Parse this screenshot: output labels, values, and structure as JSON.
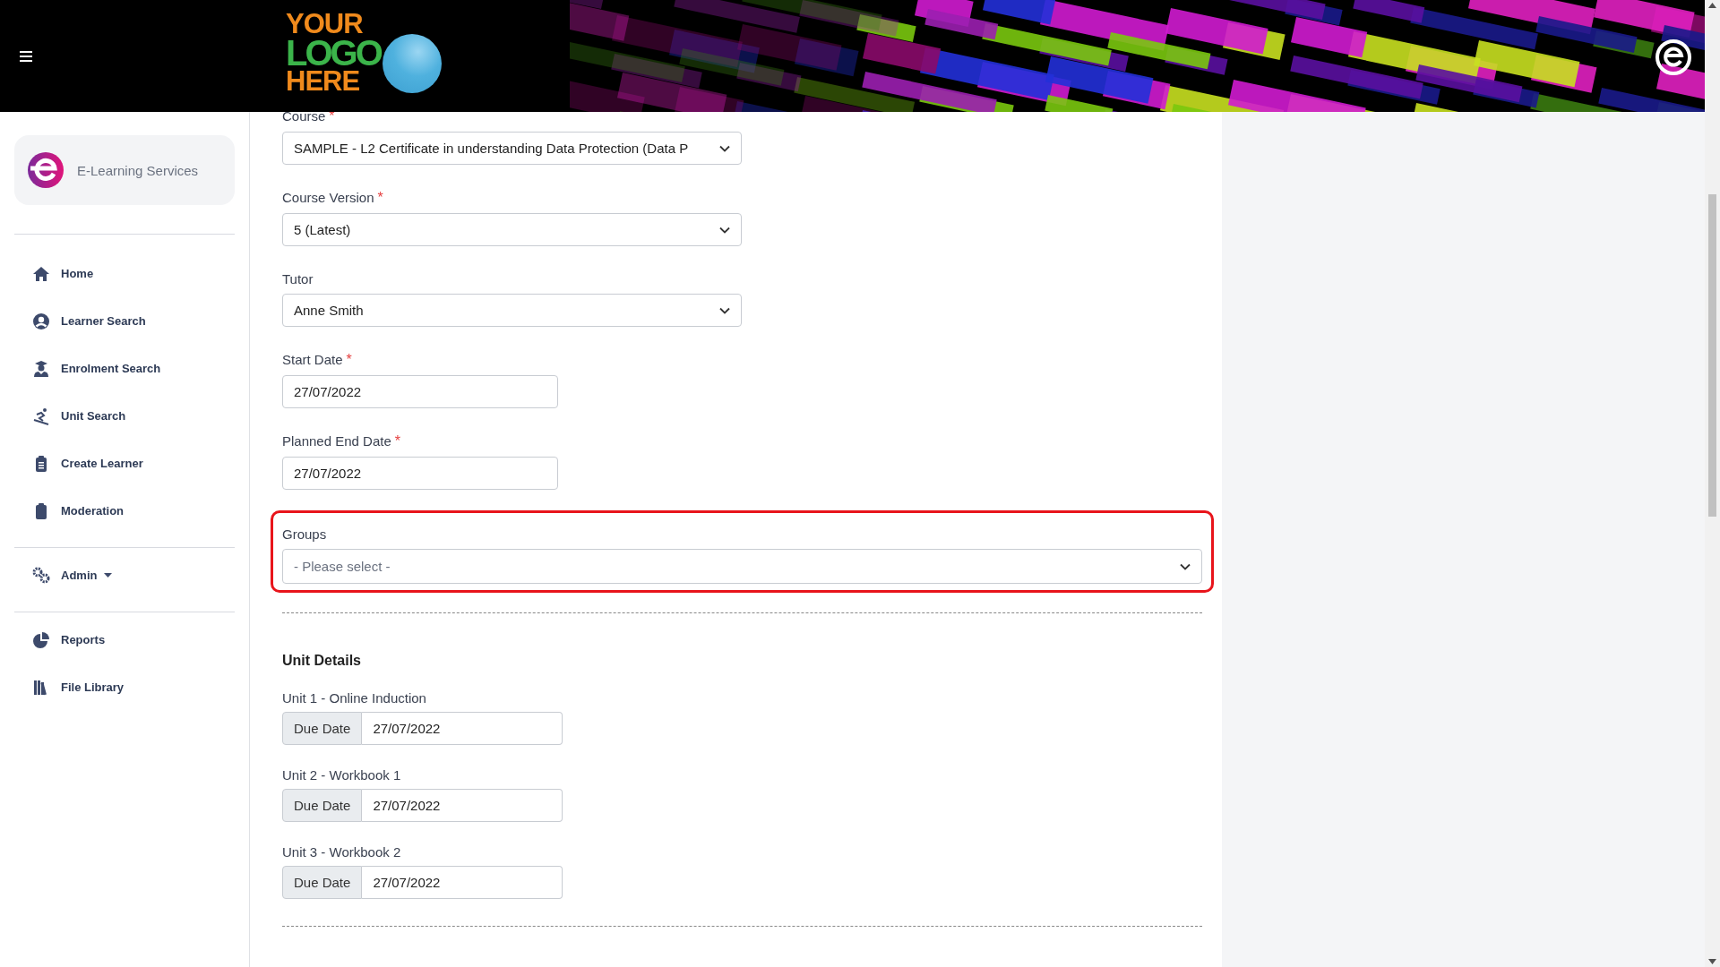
{
  "header": {
    "logo": {
      "lines": [
        "YOUR",
        "LOGO",
        "HERE"
      ]
    }
  },
  "sidebar": {
    "brand": "E-Learning Services",
    "sections": [
      [
        {
          "label": "Home",
          "kind": "link"
        },
        {
          "label": "Learner Search",
          "kind": "link"
        },
        {
          "label": "Enrolment Search",
          "kind": "link"
        },
        {
          "label": "Unit Search",
          "kind": "link"
        },
        {
          "label": "Create Learner",
          "kind": "link"
        },
        {
          "label": "Moderation",
          "kind": "link"
        }
      ],
      [
        {
          "label": "Admin",
          "kind": "dropdown"
        }
      ],
      [
        {
          "label": "Reports",
          "kind": "link"
        },
        {
          "label": "File Library",
          "kind": "link"
        }
      ]
    ]
  },
  "form": {
    "fields": [
      {
        "label": "Course",
        "required_mark": "*",
        "kind": "select",
        "value": "SAMPLE - L2 Certificate in understanding Data Protection (Data P",
        "highlighted": false
      },
      {
        "label": "Course Version",
        "required_mark": "*",
        "kind": "select",
        "value": "5 (Latest)",
        "highlighted": false
      },
      {
        "label": "Tutor",
        "kind": "select",
        "value": "Anne Smith",
        "highlighted": false
      },
      {
        "label": "Start Date",
        "required_mark": "*",
        "kind": "date",
        "value": "27/07/2022",
        "highlighted": false
      },
      {
        "label": "Planned End Date",
        "required_mark": "*",
        "kind": "date",
        "value": "27/07/2022",
        "highlighted": false
      },
      {
        "label": "Groups",
        "kind": "select",
        "placeholder": "- Please select -",
        "highlighted": true
      }
    ]
  },
  "unit_details": {
    "title": "Unit Details",
    "units": [
      {
        "label": "Unit 1 - Online Induction",
        "addon": "Due Date",
        "value": "27/07/2022"
      },
      {
        "label": "Unit 2 - Workbook 1",
        "addon": "Due Date",
        "value": "27/07/2022"
      },
      {
        "label": "Unit 3 - Workbook 2",
        "addon": "Due Date",
        "value": "27/07/2022"
      }
    ]
  }
}
